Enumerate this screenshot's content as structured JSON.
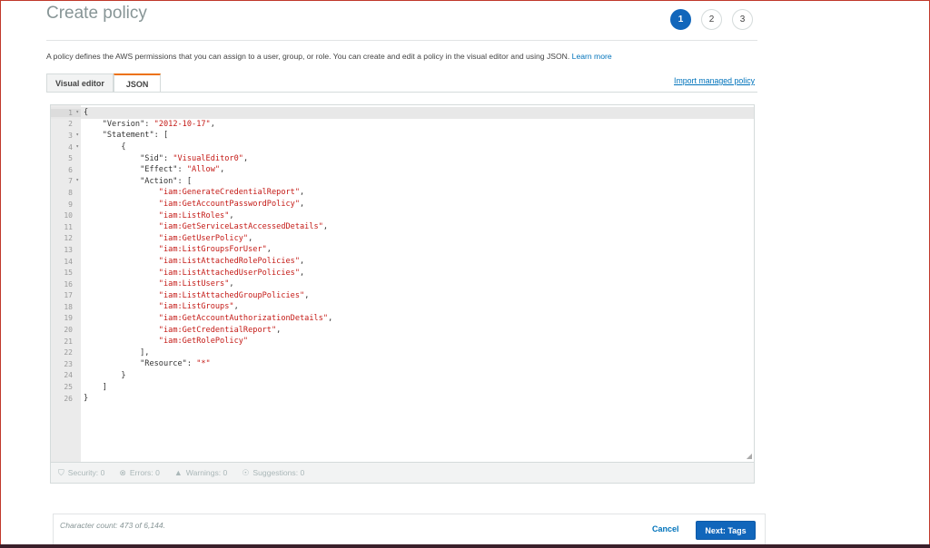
{
  "page": {
    "title": "Create policy",
    "description": "A policy defines the AWS permissions that you can assign to a user, group, or role. You can create and edit a policy in the visual editor and using JSON.",
    "learn_more": "Learn more"
  },
  "steps": [
    {
      "label": "1",
      "active": true
    },
    {
      "label": "2",
      "active": false
    },
    {
      "label": "3",
      "active": false
    }
  ],
  "tabs": {
    "visual_editor": "Visual editor",
    "json": "JSON",
    "active": "JSON"
  },
  "import_link": "Import managed policy",
  "editor": {
    "active_line": 1,
    "fold_lines": [
      1,
      3,
      4,
      7
    ],
    "lines": [
      "{",
      "    \"Version\": \"2012-10-17\",",
      "    \"Statement\": [",
      "        {",
      "            \"Sid\": \"VisualEditor0\",",
      "            \"Effect\": \"Allow\",",
      "            \"Action\": [",
      "                \"iam:GenerateCredentialReport\",",
      "                \"iam:GetAccountPasswordPolicy\",",
      "                \"iam:ListRoles\",",
      "                \"iam:GetServiceLastAccessedDetails\",",
      "                \"iam:GetUserPolicy\",",
      "                \"iam:ListGroupsForUser\",",
      "                \"iam:ListAttachedRolePolicies\",",
      "                \"iam:ListAttachedUserPolicies\",",
      "                \"iam:ListUsers\",",
      "                \"iam:ListAttachedGroupPolicies\",",
      "                \"iam:ListGroups\",",
      "                \"iam:GetAccountAuthorizationDetails\",",
      "                \"iam:GetCredentialReport\",",
      "                \"iam:GetRolePolicy\"",
      "            ],",
      "            \"Resource\": \"*\"",
      "        }",
      "    ]",
      "}"
    ]
  },
  "status": {
    "security": "Security: 0",
    "errors": "Errors: 0",
    "warnings": "Warnings: 0",
    "suggestions": "Suggestions: 0"
  },
  "footer": {
    "char_count": "Character count: 473 of 6,144.",
    "cancel": "Cancel",
    "next": "Next: Tags"
  },
  "colors": {
    "primary": "#1166bb",
    "tab_accent": "#ec7211",
    "link": "#0073bb",
    "string": "#c41a16"
  }
}
